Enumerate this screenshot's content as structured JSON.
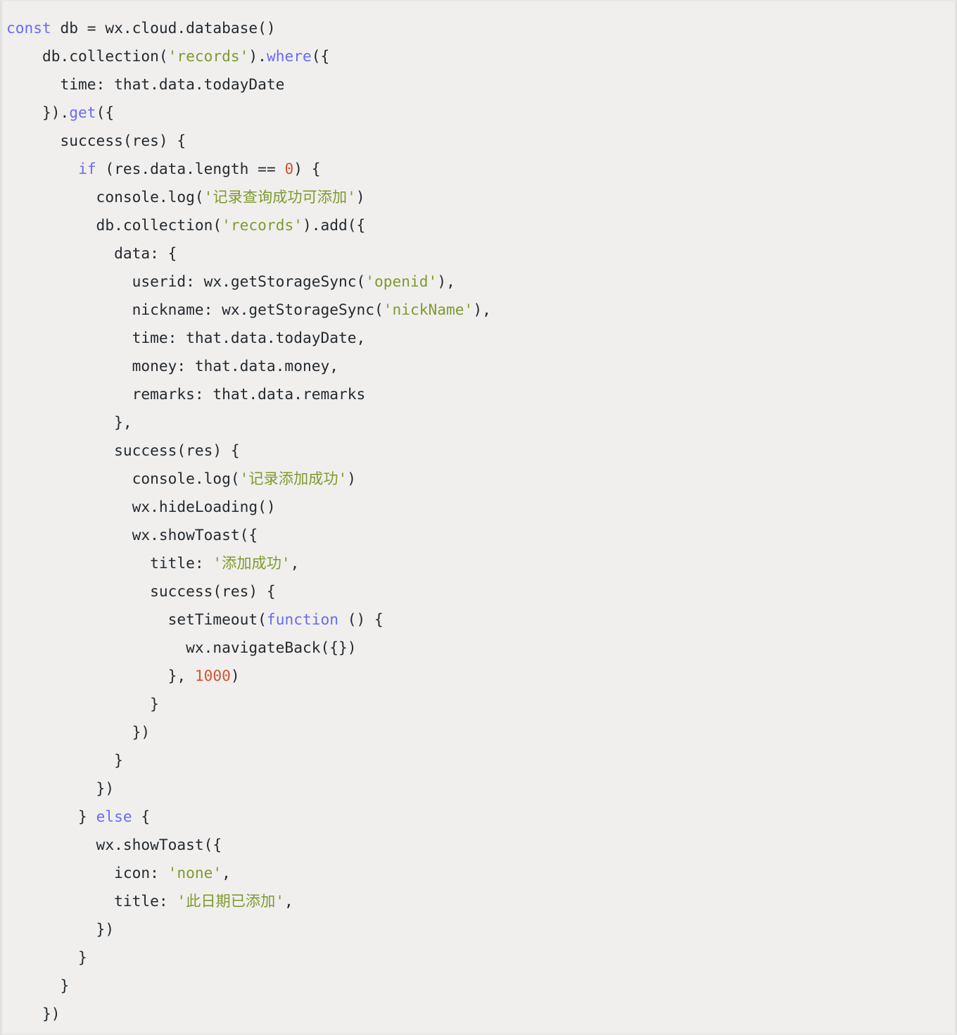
{
  "editor": {
    "language": "javascript",
    "background_color": "#f0efee",
    "border_color": "#e2e1e0",
    "colors": {
      "text": "#24292e",
      "keyword": "#6a6af2",
      "string": "#7f9a2e",
      "number": "#d2562f"
    }
  },
  "code": {
    "lines": [
      [
        {
          "t": "const",
          "c": "kw"
        },
        {
          "t": " db = wx.cloud.database()",
          "c": "txt"
        }
      ],
      [
        {
          "t": "    db.collection(",
          "c": "txt"
        },
        {
          "t": "'records'",
          "c": "str"
        },
        {
          "t": ").",
          "c": "txt"
        },
        {
          "t": "where",
          "c": "fn"
        },
        {
          "t": "({",
          "c": "txt"
        }
      ],
      [
        {
          "t": "      time: that.data.todayDate",
          "c": "txt"
        }
      ],
      [
        {
          "t": "    }).",
          "c": "txt"
        },
        {
          "t": "get",
          "c": "fn"
        },
        {
          "t": "({",
          "c": "txt"
        }
      ],
      [
        {
          "t": "      success(res) {",
          "c": "txt"
        }
      ],
      [
        {
          "t": "        ",
          "c": "txt"
        },
        {
          "t": "if",
          "c": "kw"
        },
        {
          "t": " (res.data.length == ",
          "c": "txt"
        },
        {
          "t": "0",
          "c": "num"
        },
        {
          "t": ") {",
          "c": "txt"
        }
      ],
      [
        {
          "t": "          console.log(",
          "c": "txt"
        },
        {
          "t": "'记录查询成功可添加'",
          "c": "str"
        },
        {
          "t": ")",
          "c": "txt"
        }
      ],
      [
        {
          "t": "          db.collection(",
          "c": "txt"
        },
        {
          "t": "'records'",
          "c": "str"
        },
        {
          "t": ").add({",
          "c": "txt"
        }
      ],
      [
        {
          "t": "            data: {",
          "c": "txt"
        }
      ],
      [
        {
          "t": "              userid: wx.getStorageSync(",
          "c": "txt"
        },
        {
          "t": "'openid'",
          "c": "str"
        },
        {
          "t": "),",
          "c": "txt"
        }
      ],
      [
        {
          "t": "              nickname: wx.getStorageSync(",
          "c": "txt"
        },
        {
          "t": "'nickName'",
          "c": "str"
        },
        {
          "t": "),",
          "c": "txt"
        }
      ],
      [
        {
          "t": "              time: that.data.todayDate,",
          "c": "txt"
        }
      ],
      [
        {
          "t": "              money: that.data.money,",
          "c": "txt"
        }
      ],
      [
        {
          "t": "              remarks: that.data.remarks",
          "c": "txt"
        }
      ],
      [
        {
          "t": "            },",
          "c": "txt"
        }
      ],
      [
        {
          "t": "            success(res) {",
          "c": "txt"
        }
      ],
      [
        {
          "t": "              console.log(",
          "c": "txt"
        },
        {
          "t": "'记录添加成功'",
          "c": "str"
        },
        {
          "t": ")",
          "c": "txt"
        }
      ],
      [
        {
          "t": "              wx.hideLoading()",
          "c": "txt"
        }
      ],
      [
        {
          "t": "              wx.showToast({",
          "c": "txt"
        }
      ],
      [
        {
          "t": "                title: ",
          "c": "txt"
        },
        {
          "t": "'添加成功'",
          "c": "str"
        },
        {
          "t": ",",
          "c": "txt"
        }
      ],
      [
        {
          "t": "                success(res) {",
          "c": "txt"
        }
      ],
      [
        {
          "t": "                  setTimeout(",
          "c": "txt"
        },
        {
          "t": "function",
          "c": "kw"
        },
        {
          "t": " () {",
          "c": "txt"
        }
      ],
      [
        {
          "t": "                    wx.navigateBack({})",
          "c": "txt"
        }
      ],
      [
        {
          "t": "                  }, ",
          "c": "txt"
        },
        {
          "t": "1000",
          "c": "num"
        },
        {
          "t": ")",
          "c": "txt"
        }
      ],
      [
        {
          "t": "                }",
          "c": "txt"
        }
      ],
      [
        {
          "t": "              })",
          "c": "txt"
        }
      ],
      [
        {
          "t": "            }",
          "c": "txt"
        }
      ],
      [
        {
          "t": "          })",
          "c": "txt"
        }
      ],
      [
        {
          "t": "        } ",
          "c": "txt"
        },
        {
          "t": "else",
          "c": "kw"
        },
        {
          "t": " {",
          "c": "txt"
        }
      ],
      [
        {
          "t": "          wx.showToast({",
          "c": "txt"
        }
      ],
      [
        {
          "t": "            icon: ",
          "c": "txt"
        },
        {
          "t": "'none'",
          "c": "str"
        },
        {
          "t": ",",
          "c": "txt"
        }
      ],
      [
        {
          "t": "            title: ",
          "c": "txt"
        },
        {
          "t": "'此日期已添加'",
          "c": "str"
        },
        {
          "t": ",",
          "c": "txt"
        }
      ],
      [
        {
          "t": "          })",
          "c": "txt"
        }
      ],
      [
        {
          "t": "        }",
          "c": "txt"
        }
      ],
      [
        {
          "t": "      }",
          "c": "txt"
        }
      ],
      [
        {
          "t": "    })",
          "c": "txt"
        }
      ]
    ]
  }
}
